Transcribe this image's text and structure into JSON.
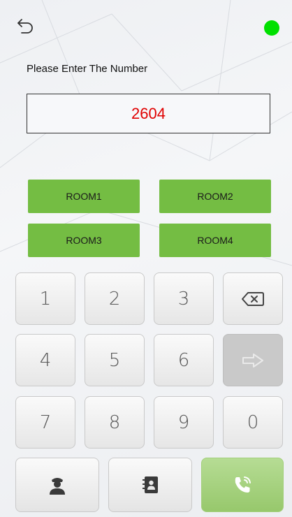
{
  "header": {
    "back_icon": "back-arrow-icon",
    "status_indicator_color": "#00e000"
  },
  "prompt": {
    "label": "Please Enter The Number"
  },
  "number_display": {
    "value": "2604"
  },
  "rooms": [
    {
      "label": "ROOM1"
    },
    {
      "label": "ROOM2"
    },
    {
      "label": "ROOM3"
    },
    {
      "label": "ROOM4"
    }
  ],
  "keypad": {
    "keys": [
      {
        "label": "1"
      },
      {
        "label": "2"
      },
      {
        "label": "3"
      },
      {
        "label": "4"
      },
      {
        "label": "5"
      },
      {
        "label": "6"
      },
      {
        "label": "7"
      },
      {
        "label": "8"
      },
      {
        "label": "9"
      },
      {
        "label": "0"
      }
    ],
    "backspace_icon": "backspace-icon",
    "enter_icon": "arrow-right-icon"
  },
  "bottom_bar": {
    "security_icon": "security-guard-icon",
    "contacts_icon": "contacts-book-icon",
    "call_icon": "phone-call-icon"
  },
  "colors": {
    "room_button": "#74bd43",
    "call_button": "#a6d27f",
    "number_text": "#e00000"
  }
}
